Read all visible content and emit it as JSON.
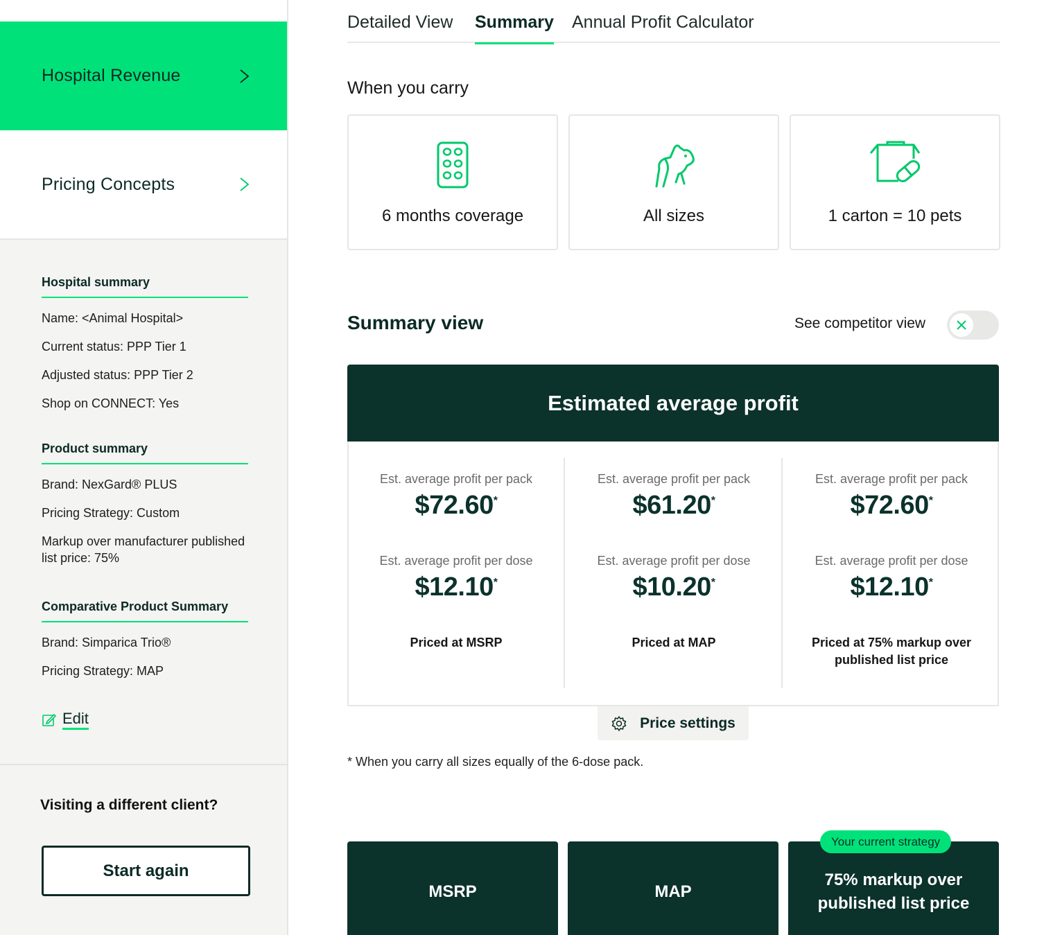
{
  "sidebar": {
    "nav": [
      {
        "label": "Hospital Revenue",
        "active": true
      },
      {
        "label": "Pricing Concepts",
        "active": false
      }
    ],
    "hospital_summary": {
      "title": "Hospital summary",
      "lines": [
        "Name: <Animal Hospital>",
        "Current status: PPP Tier 1",
        "Adjusted status: PPP Tier 2",
        "Shop on CONNECT: Yes"
      ]
    },
    "product_summary": {
      "title": "Product summary",
      "lines": [
        "Brand: NexGard® PLUS",
        "Pricing Strategy: Custom",
        "Markup over manufacturer published list price: 75%"
      ]
    },
    "comparative_summary": {
      "title": "Comparative Product Summary",
      "lines": [
        "Brand: Simparica Trio®",
        "Pricing Strategy: MAP"
      ]
    },
    "edit_label": "Edit",
    "visiting_title": "Visiting a different client?",
    "start_again_label": "Start again"
  },
  "tabs": [
    {
      "label": "Detailed View",
      "active": false
    },
    {
      "label": "Summary",
      "active": true
    },
    {
      "label": "Annual Profit Calculator",
      "active": false
    }
  ],
  "carry": {
    "title": "When you carry",
    "cards": [
      {
        "label": "6 months coverage",
        "icon": "pill-pack-icon"
      },
      {
        "label": "All sizes",
        "icon": "dog-icon"
      },
      {
        "label": "1 carton = 10 pets",
        "icon": "carton-icon"
      }
    ]
  },
  "summary_view": {
    "title": "Summary view",
    "competitor_label": "See competitor view",
    "competitor_toggle_on": false
  },
  "profit": {
    "header": "Estimated average profit",
    "columns": [
      {
        "pack_label": "Est. average profit per pack",
        "pack_value": "$72.60",
        "dose_label": "Est. average profit per dose",
        "dose_value": "$12.10",
        "basis": "Priced at MSRP"
      },
      {
        "pack_label": "Est. average profit per pack",
        "pack_value": "$61.20",
        "dose_label": "Est. average profit per dose",
        "dose_value": "$10.20",
        "basis": "Priced at MAP"
      },
      {
        "pack_label": "Est. average profit per pack",
        "pack_value": "$72.60",
        "dose_label": "Est. average profit per dose",
        "dose_value": "$12.10",
        "basis": "Priced at 75% markup over published list price"
      }
    ],
    "asterisk": "*",
    "price_settings_label": "Price settings",
    "footnote": "*  When you carry all sizes equally of the 6-dose pack."
  },
  "strategies": {
    "current_badge": "Your current strategy",
    "cards": [
      "MSRP",
      "MAP",
      "75% markup over published list price"
    ]
  },
  "colors": {
    "accent": "#00e279",
    "dark": "#0b322b"
  }
}
